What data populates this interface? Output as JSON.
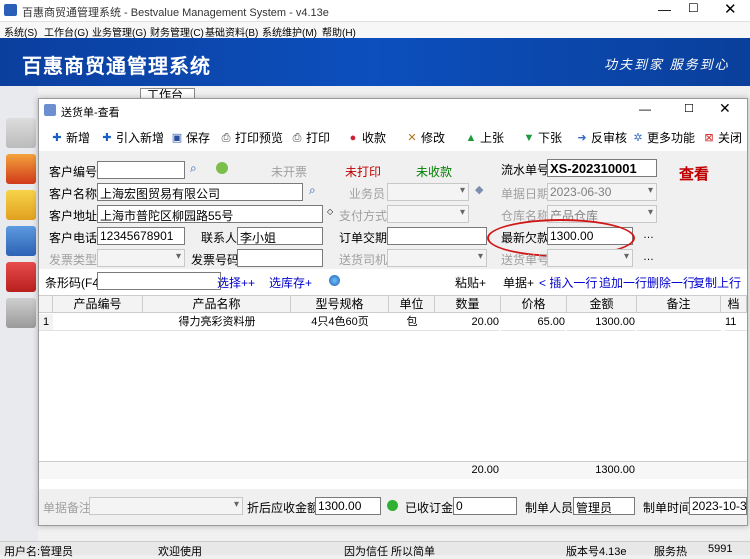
{
  "app": {
    "title": "百惠商贸通管理系统 - Bestvalue Management System - v4.13e",
    "menus": [
      "系统(S)",
      "工作台(G)",
      "业务管理(G)",
      "财务管理(C)",
      "基础资料(B)",
      "系统维护(M)",
      "帮助(H)"
    ],
    "banner_title": "百惠商贸通管理系统",
    "banner_slogan": "功夫到家 服务到心",
    "workspace_tab": "工作台"
  },
  "dialog": {
    "title": "送货单-查看",
    "view_stamp": "查看",
    "toolbar": [
      "新增",
      "引入新增",
      "保存",
      "打印预览",
      "打印",
      "收款",
      "修改",
      "上张",
      "下张",
      "反审核",
      "更多功能",
      "关闭"
    ]
  },
  "form": {
    "customer_code_label": "客户编号",
    "customer_code": "",
    "invoice_status": "未开票",
    "print_status": "未打印",
    "pay_status": "未收款",
    "serial_label": "流水单号",
    "serial": "XS-202310001",
    "customer_name_label": "客户名称",
    "customer_name": "上海宏图贸易有限公司",
    "salesman_label": "业务员",
    "date_label": "单据日期",
    "date": "2023-06-30",
    "address_label": "客户地址",
    "address": "上海市普陀区柳园路55号",
    "pay_method_label": "支付方式",
    "warehouse_label": "仓库名称",
    "warehouse": "产品仓库",
    "phone_label": "客户电话",
    "phone": "12345678901",
    "contact_label": "联系人",
    "contact": "李小姐",
    "order_label": "订单交期",
    "debt_label": "最新欠款",
    "debt": "1300.00",
    "ship_type_label": "发票类型",
    "invoice_no_label": "发票号码",
    "driver_label": "送货司机",
    "ship_no_label": "送货单号"
  },
  "barcode": {
    "label": "条形码(F4)",
    "select_plus": "选择++",
    "stock_select": "选库存+",
    "paste": "粘贴+",
    "single": "单据+",
    "insert_row": "< 插入一行",
    "add_row": "追加一行",
    "delete_row": "删除一行",
    "copy_up": "复制上行"
  },
  "grid": {
    "headers": [
      "产品编号",
      "产品名称",
      "型号规格",
      "单位",
      "数量",
      "价格",
      "金额",
      "备注",
      "档"
    ],
    "rows": [
      {
        "idx": "1",
        "code": "",
        "name": "得力亮彩资料册",
        "spec": "4只4色60页",
        "unit": "包",
        "qty": "20.00",
        "price": "65.00",
        "amount": "1300.00",
        "note": "",
        "extra": "11"
      }
    ],
    "total_qty": "20.00",
    "total_amount": "1300.00"
  },
  "bottom": {
    "note_label": "单据备注",
    "net_label": "折后应收金额",
    "net": "1300.00",
    "received_label": "已收订金",
    "received": "0",
    "maker_label": "制单人员",
    "maker": "管理员",
    "time_label": "制单时间",
    "time": "2023-10-3"
  },
  "status": {
    "user": "用户名:管理员",
    "welcome": "欢迎使用",
    "motto": "因为信任 所以简单",
    "version": "版本号4.13e",
    "service": "服务热",
    "phone": "5991"
  },
  "colors": {
    "banner": "#0c4fbd",
    "red": "#c00000",
    "green": "#008000",
    "link": "#0000cc"
  }
}
